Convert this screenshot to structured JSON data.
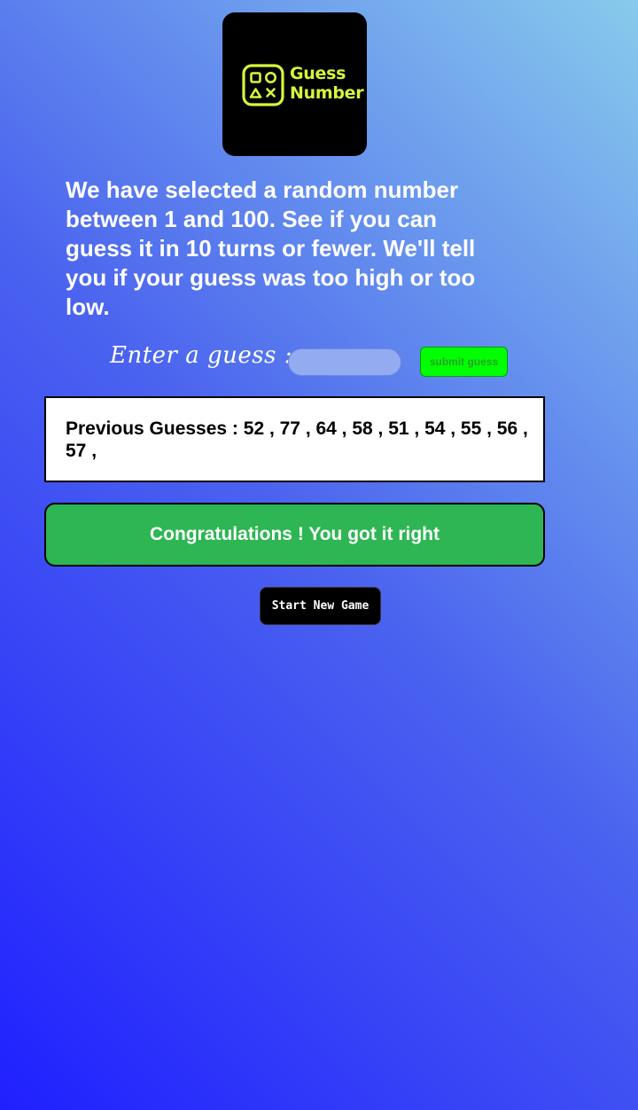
{
  "logo": {
    "line1": "Guess",
    "line2": "Number",
    "icon": "gamepad-shapes-icon",
    "color": "#d6f53a"
  },
  "intro": {
    "text": "We have selected a random number between 1 and 100. See if you can guess it in 10 turns or fewer. We'll tell you if your guess was too high or too low."
  },
  "guess_form": {
    "label": "Enter a guess :",
    "input_value": "",
    "input_placeholder": "",
    "submit_label": "submit guess"
  },
  "previous_guesses": {
    "text": "Previous Guesses : 52 , 77 , 64 , 58 , 51 , 54 , 55 , 56 , 57 ,"
  },
  "result": {
    "text": "Congratulations ! You got it right",
    "color": "#2db653"
  },
  "new_game": {
    "label": "Start New Game"
  }
}
